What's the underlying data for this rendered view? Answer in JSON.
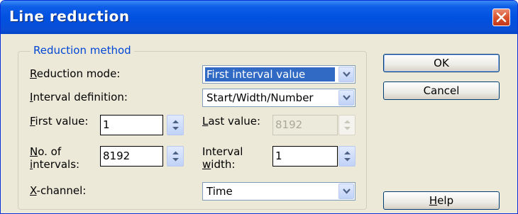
{
  "window": {
    "title": "Line reduction"
  },
  "group": {
    "title": "Reduction method"
  },
  "fields": {
    "reduction_mode": {
      "label_hot": "R",
      "label_rest": "eduction mode:",
      "value": "First interval value"
    },
    "interval_definition": {
      "label_hot": "I",
      "label_rest": "nterval definition:",
      "value": "Start/Width/Number"
    },
    "first_value": {
      "label_hot": "F",
      "label_rest": "irst value:",
      "value": "1"
    },
    "last_value": {
      "label_hot": "L",
      "label_rest": "ast value:",
      "value": "8192"
    },
    "no_of_intervals": {
      "label_hot": "N",
      "label_rest1": "o. of",
      "label_line2_hot": "i",
      "label_line2_rest": "ntervals:",
      "value": "8192"
    },
    "interval_width": {
      "label_line1": "Interval",
      "label_line2_hot": "w",
      "label_line2_rest": "idth:",
      "value": "1"
    },
    "x_channel": {
      "label_hot": "X",
      "label_rest": "-channel:",
      "value": "Time"
    }
  },
  "buttons": {
    "ok": "OK",
    "cancel": "Cancel",
    "help_hot": "H",
    "help_rest": "elp"
  },
  "icons": {
    "close": "close-x-icon",
    "dropdown": "chevron-down-icon",
    "spinner": "up-down-arrows-icon"
  },
  "colors": {
    "title_bar": "#0050e0",
    "close_button": "#d9532e",
    "selection": "#316ac5",
    "group_title": "#0046d5",
    "dialog_face": "#ece9d8"
  }
}
